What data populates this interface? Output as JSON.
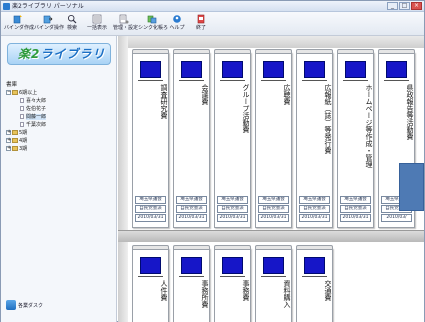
{
  "window": {
    "title": "楽2ライブラリ パーソナル",
    "buttons": {
      "minimize": "_",
      "maximize": "□",
      "close": "×"
    }
  },
  "toolbar": {
    "items": [
      {
        "label": "バインダ作成",
        "icon": "binder-new-icon"
      },
      {
        "label": "バインダ操作",
        "icon": "binder-op-icon"
      },
      {
        "label": "検索",
        "icon": "search-icon"
      },
      {
        "label": "一括表示",
        "icon": "list-view-icon"
      },
      {
        "label": "管理・設定",
        "icon": "settings-icon"
      },
      {
        "label": "シンク化帳ろ",
        "icon": "sync-icon"
      },
      {
        "label": "ヘルプ",
        "icon": "help-icon"
      },
      {
        "label": "終了",
        "icon": "exit-icon"
      }
    ]
  },
  "logo": {
    "text_a": "楽2",
    "text_b": "ライブラリ"
  },
  "tree": {
    "root": "書庫",
    "nodes": [
      {
        "label": "6期以上",
        "level": 0,
        "expanded": true,
        "icon": "folder"
      },
      {
        "label": "喜々大郎",
        "level": 1,
        "icon": "doc"
      },
      {
        "label": "佐伯花子",
        "level": 1,
        "icon": "doc"
      },
      {
        "label": "間藤一郎",
        "level": 1,
        "icon": "doc",
        "selected": true
      },
      {
        "label": "千葉次郎",
        "level": 1,
        "icon": "doc"
      },
      {
        "label": "5期",
        "level": 0,
        "expanded": false,
        "icon": "folder"
      },
      {
        "label": "4期",
        "level": 0,
        "expanded": false,
        "icon": "folder"
      },
      {
        "label": "3期",
        "level": 0,
        "expanded": false,
        "icon": "folder"
      }
    ]
  },
  "bottom_button": {
    "label": "各業ダスク"
  },
  "shelf": {
    "top_binders": [
      {
        "title": "調査研究費",
        "org1": "埼玉県議会",
        "org2": "自民党会派",
        "date": "2010/03/31"
      },
      {
        "title": "会議費",
        "org1": "埼玉県議会",
        "org2": "自民党会派",
        "date": "2010/03/31"
      },
      {
        "title": "グループ活動費",
        "org1": "埼玉県議会",
        "org2": "自民党会派",
        "date": "2010/03/31"
      },
      {
        "title": "広聴費",
        "org1": "埼玉県議会",
        "org2": "自民党会派",
        "date": "2010/03/31"
      },
      {
        "title": "広報紙（誌）等発行費",
        "org1": "埼玉県議会",
        "org2": "自民党会派",
        "date": "2010/03/31"
      },
      {
        "title": "ホームページ等作成・管理",
        "org1": "埼玉県議会",
        "org2": "自民党会派",
        "date": "2010/03/31"
      },
      {
        "title": "県政報告等活動費",
        "org1": "埼玉県議会",
        "org2": "自民党会派",
        "date": "2010/03/"
      }
    ],
    "bottom_binders": [
      {
        "title": "人件費"
      },
      {
        "title": "事務所費"
      },
      {
        "title": "事務費"
      },
      {
        "title": "資料購入"
      },
      {
        "title": "交通費"
      }
    ]
  }
}
